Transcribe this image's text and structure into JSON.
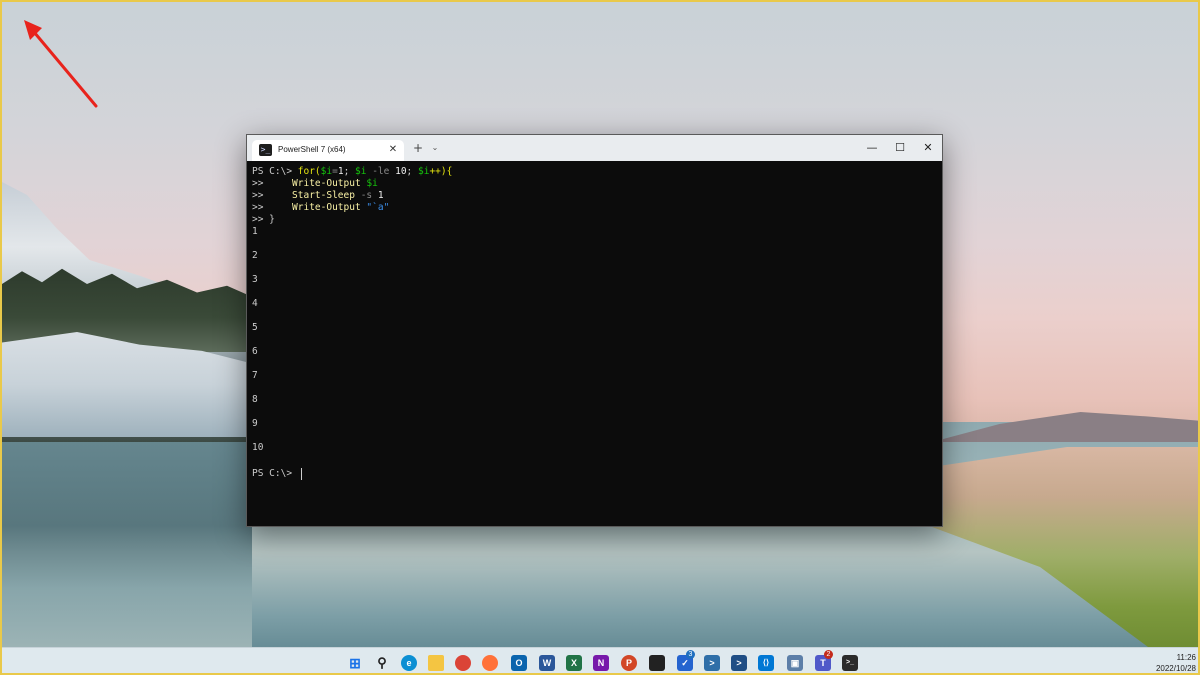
{
  "window": {
    "tab_title": "PowerShell 7 (x64)",
    "tab_icon_glyph": ">_",
    "close_tab_glyph": "✕",
    "new_tab_glyph": "+",
    "dropdown_glyph": "⌄",
    "minimize_glyph": "—",
    "maximize_glyph": "☐",
    "close_glyph": "✕"
  },
  "terminal": {
    "line1": {
      "prompt": "PS C:\\> ",
      "p1": "for(",
      "p2": "$i",
      "p3": "=",
      "p4": "1",
      "p5": "; ",
      "p6": "$i",
      "p7": " -le ",
      "p8": "10",
      "p9": "; ",
      "p10": "$i",
      "p11": "++){"
    },
    "line2": {
      "prefix": ">>     ",
      "cmd": "Write-Output",
      "space": " ",
      "var": "$i"
    },
    "line3": {
      "prefix": ">>     ",
      "cmd": "Start-Sleep",
      "op": " -s ",
      "num": "1"
    },
    "line4": {
      "prefix": ">>     ",
      "cmd": "Write-Output",
      "space": " ",
      "str": "\"`a\""
    },
    "line5": ">> }",
    "outputs": [
      "1",
      "2",
      "3",
      "4",
      "5",
      "6",
      "7",
      "8",
      "9",
      "10"
    ],
    "final_prompt": "PS C:\\> "
  },
  "taskbar": {
    "icons": [
      {
        "name": "start",
        "glyph": "⊞",
        "color": "#1a73e8"
      },
      {
        "name": "search",
        "glyph": "⚲",
        "color": "#222222"
      },
      {
        "name": "edge",
        "glyph": "e",
        "color": "#0c8fd3"
      },
      {
        "name": "file-explorer",
        "glyph": "",
        "color": "#f4c542"
      },
      {
        "name": "chrome",
        "glyph": "",
        "color": "#db4437"
      },
      {
        "name": "firefox",
        "glyph": "",
        "color": "#ff7139"
      },
      {
        "name": "outlook",
        "glyph": "O",
        "color": "#0a64ad"
      },
      {
        "name": "word",
        "glyph": "W",
        "color": "#2b579a"
      },
      {
        "name": "excel",
        "glyph": "X",
        "color": "#217346"
      },
      {
        "name": "onenote",
        "glyph": "N",
        "color": "#7719aa"
      },
      {
        "name": "powerpoint",
        "glyph": "P",
        "color": "#d24726"
      },
      {
        "name": "sticky-notes",
        "glyph": "",
        "color": "#222222"
      },
      {
        "name": "todo",
        "glyph": "✓",
        "color": "#2564cf"
      },
      {
        "name": "powershell",
        "glyph": ">",
        "color": "#2f6fa8"
      },
      {
        "name": "powershell-2",
        "glyph": ">",
        "color": "#1f4e85"
      },
      {
        "name": "vscode",
        "glyph": "⟨⟩",
        "color": "#0078d4"
      },
      {
        "name": "remote-desktop",
        "glyph": "▣",
        "color": "#5c7fa8"
      },
      {
        "name": "teams",
        "glyph": "T",
        "color": "#5059c9"
      },
      {
        "name": "terminal",
        "glyph": ">_",
        "color": "#2b2b2b"
      }
    ],
    "todo_badge": "3",
    "teams_badge": "2",
    "time": "11:26",
    "date": "2022/10/28"
  }
}
